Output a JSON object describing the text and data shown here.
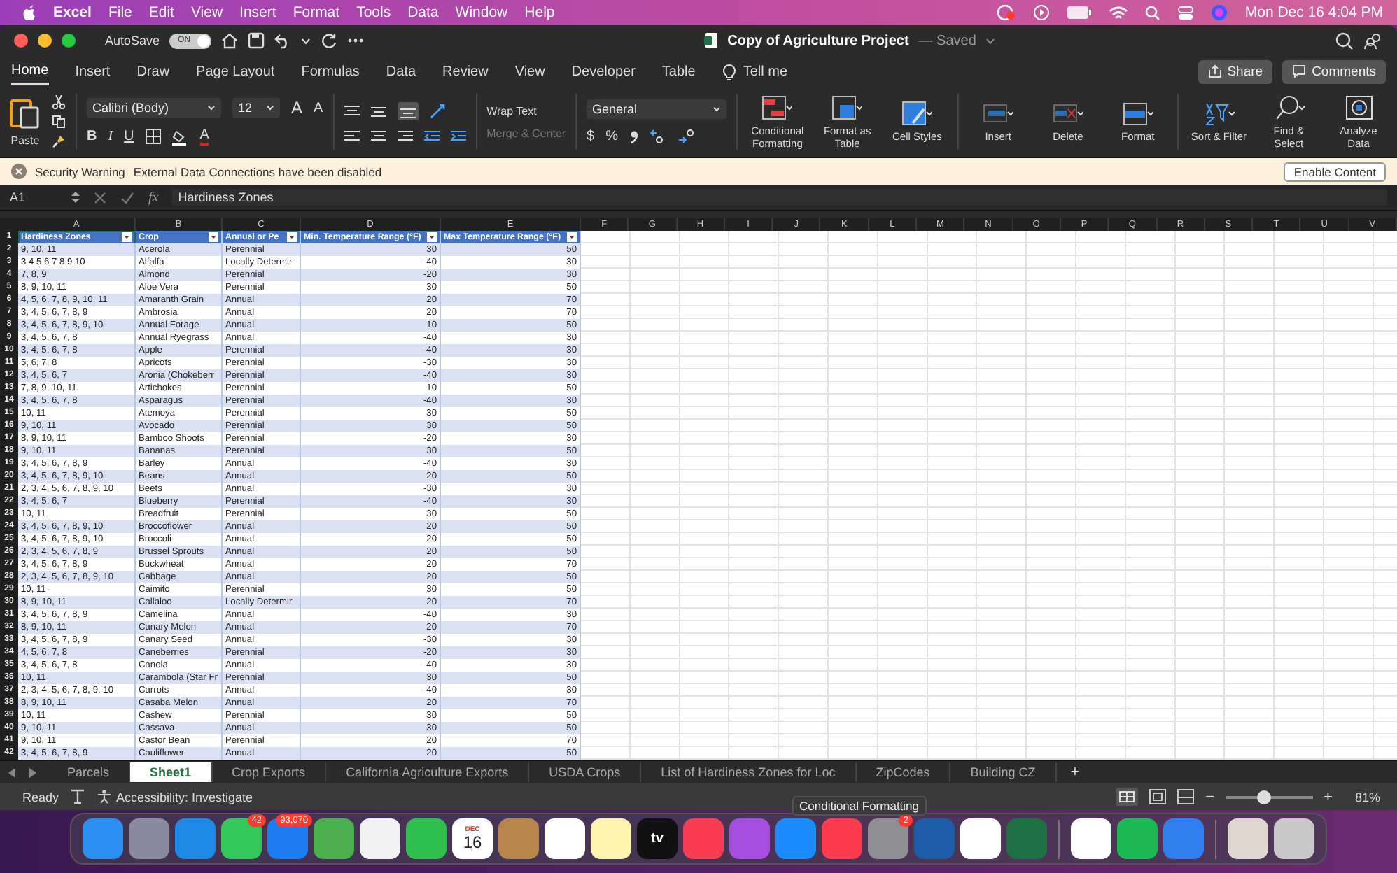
{
  "menubar": {
    "app": "Excel",
    "items": [
      "File",
      "Edit",
      "View",
      "Insert",
      "Format",
      "Tools",
      "Data",
      "Window",
      "Help"
    ],
    "clock": "Mon Dec 16  4:04 PM"
  },
  "window": {
    "autosave": "AutoSave",
    "autosave_on": true,
    "autosave_state": "ON",
    "title": "Copy of Agriculture Project",
    "saved": "— Saved"
  },
  "ribbon": {
    "tabs": [
      {
        "label": "Home",
        "selected": true
      },
      {
        "label": "Insert",
        "selected": false
      },
      {
        "label": "Draw",
        "selected": false
      },
      {
        "label": "Page Layout",
        "selected": false
      },
      {
        "label": "Formulas",
        "selected": false
      },
      {
        "label": "Data",
        "selected": false
      },
      {
        "label": "Review",
        "selected": false
      },
      {
        "label": "View",
        "selected": false
      },
      {
        "label": "Developer",
        "selected": false
      },
      {
        "label": "Table",
        "selected": false
      }
    ],
    "tell_me": "Tell me",
    "share": "Share",
    "comments": "Comments",
    "paste": "Paste",
    "font": "Calibri (Body)",
    "size": "12",
    "grow": "A",
    "shrink": "A",
    "bold": "B",
    "italic": "I",
    "underline": "U",
    "font_color": "A",
    "wrap": {
      "label": "Wrap Text",
      "disabled": false
    },
    "merge": {
      "label": "Merge & Center",
      "disabled": true
    },
    "number_format": "General",
    "currency": "$",
    "percent": "%",
    "big_buttons": [
      {
        "label": "Conditional Formatting",
        "kind": "conditional"
      },
      {
        "label": "Format as Table",
        "kind": "table"
      },
      {
        "label": "Cell Styles",
        "kind": "styles"
      },
      {
        "label": "Insert",
        "kind": "insert"
      },
      {
        "label": "Delete",
        "kind": "delete"
      },
      {
        "label": "Format",
        "kind": "format"
      },
      {
        "label": "Sort & Filter",
        "kind": "sort"
      },
      {
        "label": "Find & Select",
        "kind": "find"
      },
      {
        "label": "Analyze Data",
        "kind": "analyze"
      }
    ]
  },
  "security": {
    "title": "Security Warning",
    "message": "External Data Connections have been disabled",
    "button": "Enable Content"
  },
  "formula_bar": {
    "cell": "A1",
    "fx": "fx",
    "value": "Hardiness Zones"
  },
  "sheet": {
    "columns": [
      "A",
      "B",
      "C",
      "D",
      "E",
      "F",
      "G",
      "H",
      "I",
      "J",
      "K",
      "L",
      "M",
      "N",
      "O",
      "P",
      "Q",
      "R",
      "S",
      "T",
      "U",
      "V"
    ],
    "header_row": "1",
    "header": [
      {
        "text": "Hardiness Zones",
        "selected": true
      },
      {
        "text": "Crop",
        "selected": false
      },
      {
        "text": "Annual or Pe",
        "selected": false
      },
      {
        "text": "Min. Temperature Range (°F)",
        "selected": false
      },
      {
        "text": "Max Temperature Range (°F)",
        "selected": false
      }
    ],
    "rows": [
      [
        "2",
        "9, 10, 11",
        "Acerola",
        "Perennial",
        "30",
        "50"
      ],
      [
        "3",
        "3 4 5 6 7 8 9 10",
        "Alfalfa",
        "Locally Determir",
        "-40",
        "30"
      ],
      [
        "4",
        "7, 8, 9",
        "Almond",
        "Perennial",
        "-20",
        "30"
      ],
      [
        "5",
        "8, 9, 10, 11",
        "Aloe Vera",
        "Perennial",
        "30",
        "50"
      ],
      [
        "6",
        "4, 5, 6, 7, 8, 9, 10, 11",
        "Amaranth Grain",
        "Annual",
        "20",
        "70"
      ],
      [
        "7",
        "3, 4, 5, 6, 7, 8, 9",
        "Ambrosia",
        "Annual",
        "20",
        "70"
      ],
      [
        "8",
        "3, 4, 5, 6, 7, 8, 9, 10",
        "Annual Forage",
        "Annual",
        "10",
        "50"
      ],
      [
        "9",
        "3, 4, 5, 6, 7, 8",
        "Annual Ryegrass",
        "Annual",
        "-40",
        "30"
      ],
      [
        "10",
        "3, 4, 5, 6, 7, 8",
        "Apple",
        "Perennial",
        "-40",
        "30"
      ],
      [
        "11",
        "5, 6, 7, 8",
        "Apricots",
        "Perennial",
        "-30",
        "30"
      ],
      [
        "12",
        "3, 4, 5, 6, 7",
        "Aronia (Chokeberr",
        "Perennial",
        "-40",
        "30"
      ],
      [
        "13",
        "7, 8, 9, 10, 11",
        "Artichokes",
        "Perennial",
        "10",
        "50"
      ],
      [
        "14",
        "3, 4, 5, 6, 7, 8",
        "Asparagus",
        "Perennial",
        "-40",
        "30"
      ],
      [
        "15",
        "10, 11",
        "Atemoya",
        "Perennial",
        "30",
        "50"
      ],
      [
        "16",
        "9, 10, 11",
        "Avocado",
        "Perennial",
        "30",
        "50"
      ],
      [
        "17",
        "8, 9, 10, 11",
        "Bamboo Shoots",
        "Perennial",
        "-20",
        "30"
      ],
      [
        "18",
        "9, 10, 11",
        "Bananas",
        "Perennial",
        "30",
        "50"
      ],
      [
        "19",
        "3, 4, 5, 6, 7, 8, 9",
        "Barley",
        "Annual",
        "-40",
        "30"
      ],
      [
        "20",
        "3, 4, 5, 6, 7, 8, 9, 10",
        "Beans",
        "Annual",
        "20",
        "50"
      ],
      [
        "21",
        "2, 3, 4, 5, 6, 7, 8, 9, 10",
        "Beets",
        "Annual",
        "-30",
        "30"
      ],
      [
        "22",
        "3, 4, 5, 6, 7",
        "Blueberry",
        "Perennial",
        "-40",
        "30"
      ],
      [
        "23",
        "10, 11",
        "Breadfruit",
        "Perennial",
        "30",
        "50"
      ],
      [
        "24",
        "3, 4, 5, 6, 7, 8, 9, 10",
        "Broccoflower",
        "Annual",
        "20",
        "50"
      ],
      [
        "25",
        "3, 4, 5, 6, 7, 8, 9, 10",
        "Broccoli",
        "Annual",
        "20",
        "50"
      ],
      [
        "26",
        "2, 3, 4, 5, 6, 7, 8, 9",
        "Brussel Sprouts",
        "Annual",
        "20",
        "50"
      ],
      [
        "27",
        "3, 4, 5, 6, 7, 8, 9",
        "Buckwheat",
        "Annual",
        "20",
        "70"
      ],
      [
        "28",
        "2, 3, 4, 5, 6, 7, 8, 9, 10",
        "Cabbage",
        "Annual",
        "20",
        "50"
      ],
      [
        "29",
        "10, 11",
        "Caimito",
        "Perennial",
        "30",
        "50"
      ],
      [
        "30",
        "8, 9, 10, 11",
        "Callaloo",
        "Locally Determir",
        "20",
        "70"
      ],
      [
        "31",
        "3, 4, 5, 6, 7, 8, 9",
        "Camelina",
        "Annual",
        "-40",
        "30"
      ],
      [
        "32",
        "8, 9, 10, 11",
        "Canary Melon",
        "Annual",
        "20",
        "70"
      ],
      [
        "33",
        "3, 4, 5, 6, 7, 8, 9",
        "Canary Seed",
        "Annual",
        "-30",
        "30"
      ],
      [
        "34",
        "4, 5, 6, 7, 8",
        "Caneberries",
        "Perennial",
        "-20",
        "30"
      ],
      [
        "35",
        "3, 4, 5, 6, 7, 8",
        "Canola",
        "Annual",
        "-40",
        "30"
      ],
      [
        "36",
        "10, 11",
        "Carambola (Star Fr",
        "Perennial",
        "30",
        "50"
      ],
      [
        "37",
        "2, 3, 4, 5, 6, 7, 8, 9, 10",
        "Carrots",
        "Annual",
        "-40",
        "30"
      ],
      [
        "38",
        "8, 9, 10, 11",
        "Casaba Melon",
        "Annual",
        "20",
        "70"
      ],
      [
        "39",
        "10, 11",
        "Cashew",
        "Perennial",
        "30",
        "50"
      ],
      [
        "40",
        "9, 10, 11",
        "Cassava",
        "Annual",
        "30",
        "50"
      ],
      [
        "41",
        "9, 10, 11",
        "Castor Bean",
        "Perennial",
        "20",
        "70"
      ],
      [
        "42",
        "3, 4, 5, 6, 7, 8, 9",
        "Cauliflower",
        "Annual",
        "20",
        "50"
      ]
    ]
  },
  "sheet_tabs": [
    {
      "label": "Parcels",
      "selected": false
    },
    {
      "label": "Sheet1",
      "selected": true
    },
    {
      "label": "Crop Exports",
      "selected": false
    },
    {
      "label": "California Agriculture Exports",
      "selected": false
    },
    {
      "label": "USDA Crops",
      "selected": false
    },
    {
      "label": "List of Hardiness Zones for Loc",
      "selected": false
    },
    {
      "label": "ZipCodes",
      "selected": false
    },
    {
      "label": "Building CZ",
      "selected": false
    }
  ],
  "add_sheet": "+",
  "status_bar": {
    "ready": "Ready",
    "accessibility": "Accessibility: Investigate",
    "zoom_out": "−",
    "zoom_in": "+",
    "level": 0.45,
    "zoom": "81%"
  },
  "tooltip": "Conditional Formatting",
  "dock": [
    {
      "kind": "app",
      "color": "#2a8ff0"
    },
    {
      "kind": "app",
      "color": "#8a8aa0"
    },
    {
      "kind": "app",
      "color": "#1e88e5"
    },
    {
      "kind": "app",
      "color": "#34c759",
      "badge": "42"
    },
    {
      "kind": "app",
      "color": "#1e7cf2",
      "badge": "93,070"
    },
    {
      "kind": "app",
      "color": "#4caf50"
    },
    {
      "kind": "app",
      "color": "#f2f2f2"
    },
    {
      "kind": "app",
      "color": "#2fbf4f"
    },
    {
      "kind": "calendar",
      "color": "#ffffff",
      "month": "DEC",
      "day": "16"
    },
    {
      "kind": "app",
      "color": "#b8864b"
    },
    {
      "kind": "app",
      "color": "#ffffff"
    },
    {
      "kind": "app",
      "color": "#fff3b0"
    },
    {
      "kind": "tv",
      "color": "#111111",
      "text": "tv"
    },
    {
      "kind": "app",
      "color": "#fa3d52"
    },
    {
      "kind": "app",
      "color": "#a64ee0"
    },
    {
      "kind": "app",
      "color": "#1a8cff"
    },
    {
      "kind": "app",
      "color": "#ff3b4f"
    },
    {
      "kind": "app",
      "color": "#8e8e93",
      "badge": "2"
    },
    {
      "kind": "app",
      "color": "#1c5ca8"
    },
    {
      "kind": "app",
      "color": "#ffffff"
    },
    {
      "kind": "app",
      "color": "#1d7044"
    },
    {
      "kind": "divider"
    },
    {
      "kind": "app",
      "color": "#ffffff"
    },
    {
      "kind": "app",
      "color": "#1db954"
    },
    {
      "kind": "app",
      "color": "#2f7ff0"
    },
    {
      "kind": "divider"
    },
    {
      "kind": "app",
      "color": "#e0d8d0"
    },
    {
      "kind": "app",
      "color": "#c8c8c8"
    }
  ]
}
